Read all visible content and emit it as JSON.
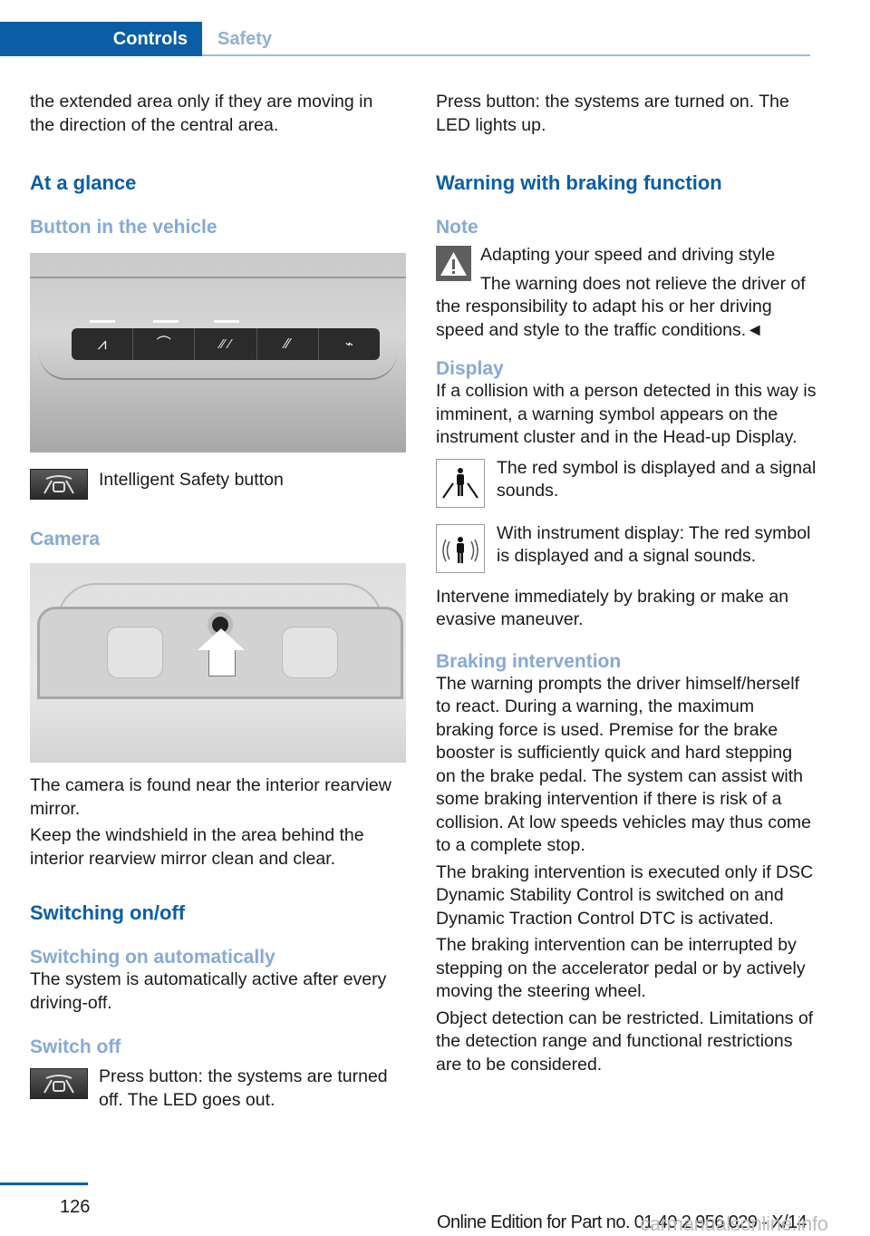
{
  "header": {
    "tab_active": "Controls",
    "tab_inactive": "Safety",
    "accent_color": "#0a5ea8",
    "sub_color": "#86a9d6"
  },
  "left": {
    "intro": "the extended area only if they are moving in the direction of the central area.",
    "at_a_glance": "At a glance",
    "button_heading": "Button in the vehicle",
    "button_panel_icons": [
      "lane-departure-icon",
      "intelligent-safety-icon",
      "night-vision-icon",
      "lane-change-icon",
      "park-assist-icon"
    ],
    "intelligent_safety_caption": "Intelligent Safety button",
    "camera_heading": "Camera",
    "camera_text_1": "The camera is found near the interior rearview mirror.",
    "camera_text_2": "Keep the windshield in the area behind the interior rearview mirror clean and clear.",
    "switching_heading": "Switching on/off",
    "switching_auto_heading": "Switching on automatically",
    "switching_auto_text": "The system is automatically active after every driving-off.",
    "switch_off_heading": "Switch off",
    "switch_off_text": "Press button: the systems are turned off. The LED goes out."
  },
  "right": {
    "switch_on_text": "Press button: the systems are turned on. The LED lights up.",
    "warning_heading": "Warning with braking function",
    "note_heading": "Note",
    "note_title": "Adapting your speed and driving style",
    "note_body": "The warning does not relieve the driver of the responsibility to adapt his or her driving speed and style to the traffic conditions.◄",
    "display_heading": "Display",
    "display_text": "If a collision with a person detected in this way is imminent, a warning symbol appears on the instrument cluster and in the Head-up Display.",
    "symbol1_text": "The red symbol is displayed and a signal sounds.",
    "symbol2_text": "With instrument display: The red symbol is displayed and a signal sounds.",
    "intervene_text": "Intervene immediately by braking or make an evasive maneuver.",
    "braking_heading": "Braking intervention",
    "braking_text_1": "The warning prompts the driver himself/herself to react. During a warning, the maximum braking force is used. Premise for the brake booster is sufficiently quick and hard stepping on the brake pedal. The system can assist with some braking intervention if there is risk of a collision. At low speeds vehicles may thus come to a complete stop.",
    "braking_text_2": "The braking intervention is executed only if DSC Dynamic Stability Control is switched on and Dynamic Traction Control DTC is activated.",
    "braking_text_3": "The braking intervention can be interrupted by stepping on the accelerator pedal or by actively moving the steering wheel.",
    "braking_text_4": "Object detection can be restricted. Limitations of the detection range and functional restrictions are to be considered."
  },
  "footer": {
    "page_number": "126",
    "edition": "Online Edition for Part no. 01 40 2 956 029 - X/14",
    "watermark": "carmanualsonline.info"
  }
}
